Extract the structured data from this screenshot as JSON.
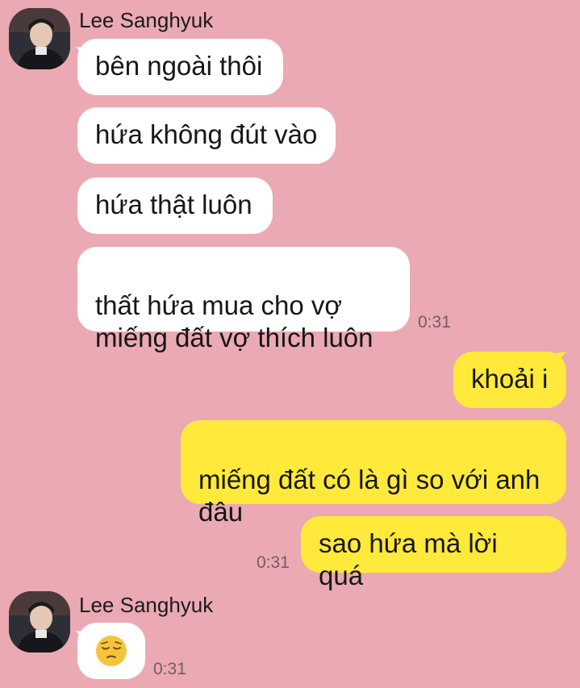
{
  "chat": {
    "group1": {
      "sender": "Lee Sanghyuk",
      "messages": [
        "bên ngoài thôi",
        "hứa không đút vào",
        "hứa thật luôn",
        "thất hứa mua cho vợ\nmiếng đất vợ thích luôn"
      ],
      "time": "0:31"
    },
    "outgoing": {
      "messages": [
        "khoải i",
        "miếng đất có là gì so với anh\nđâu",
        "sao hứa mà lời quá"
      ],
      "time": "0:31"
    },
    "group2": {
      "sender": "Lee Sanghyuk",
      "emoji_icon": "pensive-face-emoji",
      "time": "0:31"
    }
  },
  "colors": {
    "background": "#eba9b3",
    "incoming_bubble": "#ffffff",
    "outgoing_bubble": "#ffe93a"
  }
}
